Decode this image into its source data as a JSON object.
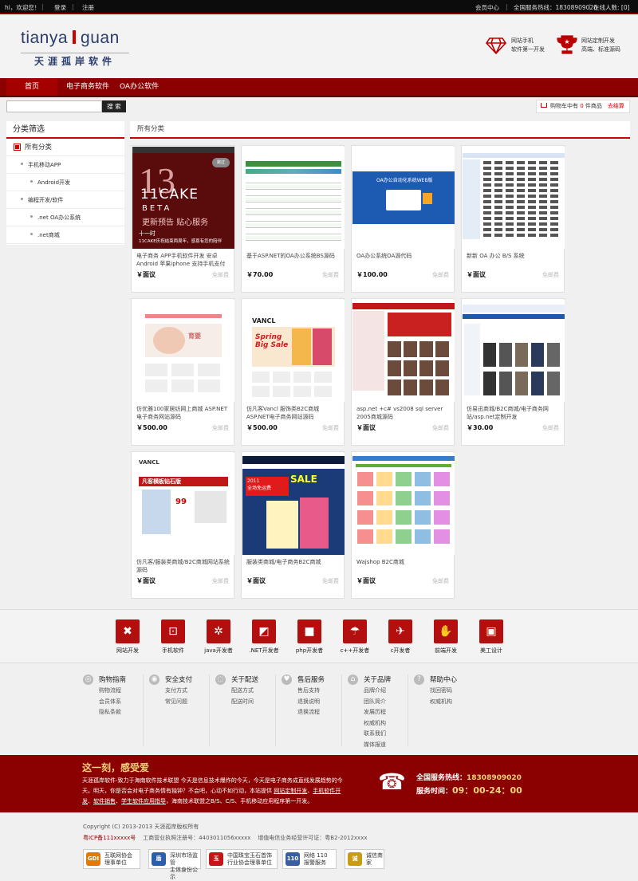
{
  "topbar": {
    "welcome": "hi，欢迎您！",
    "login": "登录",
    "register": "注册",
    "member_center": "会员中心",
    "hotline_label": "全国服务热线：18308909020",
    "online_label": "在线人数: [0]"
  },
  "header": {
    "logo_en_left": "tianya",
    "logo_en_right": "guan",
    "logo_cn": "天涯孤岸软件",
    "info1_line1": "网站手机",
    "info1_line2": "软件第一开发",
    "info2_line1": "网站定制开发",
    "info2_line2": "高端、标准源码"
  },
  "nav": [
    "首页",
    "电子商务软件",
    "OA办公软件"
  ],
  "search": {
    "button": "搜 索",
    "placeholder": ""
  },
  "cart": {
    "text1": "购物车中有 ",
    "count": "0",
    "text2": " 件商品",
    "checkout": "去结算"
  },
  "sidebar": {
    "title": "分类筛选",
    "items": [
      {
        "label": "所有分类",
        "level": 0
      },
      {
        "label": "手机移动APP",
        "level": 1
      },
      {
        "label": "Android开发",
        "level": 2
      },
      {
        "label": "编程开发/软件",
        "level": 1
      },
      {
        "label": ".net OA办公系统",
        "level": 2
      },
      {
        "label": ".net商城",
        "level": 2
      }
    ]
  },
  "main_title": "所有分类",
  "products": [
    {
      "name": "电子商务 APP手机软件开发 安卓Android 苹果iphone 支持手机支付",
      "price": "￥面议",
      "ship": "免邮费",
      "img": "phone"
    },
    {
      "name": "基于ASP.NET的OA办公系统BS源码",
      "price": "￥70.00",
      "ship": "免邮费",
      "img": "oa-table"
    },
    {
      "name": "OA办公系统OA源代码",
      "price": "￥100.00",
      "ship": "免邮费",
      "img": "oa-login"
    },
    {
      "name": "新新 OA 办公 B/S 系统",
      "price": "￥面议",
      "ship": "免邮费",
      "img": "oa-list"
    },
    {
      "name": "仿优雅100家居纺网上商城 ASP.NET电子商务网站源码",
      "price": "￥500.00",
      "ship": "免邮费",
      "img": "baby"
    },
    {
      "name": "仿凡客Vancl 服饰类B2C商城 ASP.NET电子商务网站源码",
      "price": "￥500.00",
      "ship": "免邮费",
      "img": "vancl"
    },
    {
      "name": "asp.net +c# vs2008 sql server 2005商城源码",
      "price": "￥面议",
      "ship": "免邮费",
      "img": "shop-red"
    },
    {
      "name": "仿易迅商城/B2C商城/电子商务网站/asp.net定制开发",
      "price": "￥30.00",
      "ship": "免邮费",
      "img": "clothes"
    },
    {
      "name": "仿凡客/服装类商城/B2C商城网站系统源码",
      "price": "￥面议",
      "ship": "免邮费",
      "img": "vancl2"
    },
    {
      "name": "服装类商城/电子商务B2C商城",
      "price": "￥面议",
      "ship": "免邮费",
      "img": "fashion"
    },
    {
      "name": "Wajshop B2C商城",
      "price": "￥面议",
      "ship": "免邮费",
      "img": "wajshop"
    }
  ],
  "categories": [
    {
      "label": "网站开发",
      "icon": "tools-icon",
      "glyph": "✖"
    },
    {
      "label": "手机软件",
      "icon": "cart-icon",
      "glyph": "⊡"
    },
    {
      "label": "java开发者",
      "icon": "gear-icon",
      "glyph": "✲"
    },
    {
      "label": ".NET开发者",
      "icon": "chart-icon",
      "glyph": "◩"
    },
    {
      "label": "php开发者",
      "icon": "truck-icon",
      "glyph": "■"
    },
    {
      "label": "c++开发者",
      "icon": "umbrella-icon",
      "glyph": "☂"
    },
    {
      "label": "c开发者",
      "icon": "plane-icon",
      "glyph": "✈"
    },
    {
      "label": "前端开发",
      "icon": "thumb-icon",
      "glyph": "✋"
    },
    {
      "label": "美工设计",
      "icon": "screen-icon",
      "glyph": "▣"
    }
  ],
  "help": [
    {
      "title": "购物指南",
      "items": [
        "购物流程",
        "会员体系",
        "隐私条款"
      ],
      "icon": "guide-icon"
    },
    {
      "title": "安全支付",
      "items": [
        "支付方式",
        "常见问题"
      ],
      "icon": "shield-icon"
    },
    {
      "title": "关于配送",
      "items": [
        "配送方式",
        "配送时间"
      ],
      "icon": "truck-icon"
    },
    {
      "title": "售后服务",
      "items": [
        "售后支持",
        "退换说明",
        "退换流程"
      ],
      "icon": "heart-icon"
    },
    {
      "title": "关于品牌",
      "items": [
        "品牌介绍",
        "团队简介",
        "发展历程",
        "权威机构",
        "联系我们",
        "媒体报道"
      ],
      "icon": "home-icon"
    },
    {
      "title": "帮助中心",
      "items": [
        "找回密码",
        "权威机构"
      ],
      "icon": "question-icon"
    }
  ],
  "promo": {
    "slogan": "这一刻，感受爱",
    "desc_part1": "天涯孤岸软件-致力于海南软件技术联盟 今天是信息技术爆炸的今天，今天是电子商务成直线发展趋势的今天。明天，你是否会对电子商务情有独钟？不会吧，心动不如行动，本站提供 ",
    "link1": "网站定制开发",
    "sep1": "、",
    "link2": "手机软件开发",
    "sep2": "、",
    "link3": "软件销售",
    "sep3": "、",
    "link4": "学生软件应用指导",
    "desc_part2": "，海南技术联盟之B/S、C/S、手机移动应用程序第一开发。",
    "hotline_label": "全国服务热线：",
    "hotline": "18308909020",
    "time_label": "服务时间：",
    "time": "09：00-24：00"
  },
  "footer": {
    "copyright": "Copyright (C) 2013-2013 天涯孤岸版权所有",
    "icp": "粤ICP备111xxxxx号",
    "license": "工商营业执照注册号：4403011056xxxxx",
    "telecom": "增值电信业务经营许可证：粤B2-2012xxxx"
  },
  "badges": [
    {
      "short": "GDI",
      "line1": "互联网协会",
      "line2": "理事单位",
      "color": "#e07a00"
    },
    {
      "short": "盾",
      "line1": "深圳市场监管",
      "line2": "主体身份公示",
      "color": "#2d5ea8"
    },
    {
      "short": "玉",
      "line1": "中国珠宝玉石首饰",
      "line2": "行业协会理事单位",
      "color": "#c01818"
    },
    {
      "short": "110",
      "line1": "网络 110",
      "line2": "报警服务",
      "color": "#3a5fa0"
    },
    {
      "short": "诚",
      "line1": "诚信商家",
      "line2": "",
      "color": "#c89b18"
    }
  ]
}
